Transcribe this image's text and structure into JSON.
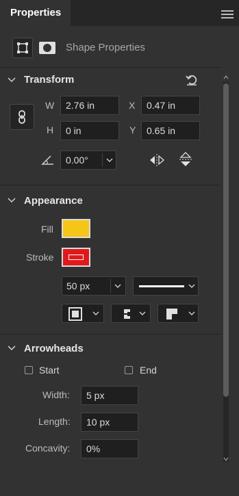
{
  "panel": {
    "tab_title": "Properties"
  },
  "shape_header": {
    "title": "Shape Properties"
  },
  "transform": {
    "title": "Transform",
    "w_label": "W",
    "w_value": "2.76 in",
    "x_label": "X",
    "x_value": "0.47 in",
    "h_label": "H",
    "h_value": "0 in",
    "y_label": "Y",
    "y_value": "0.65 in",
    "angle_value": "0.00°"
  },
  "appearance": {
    "title": "Appearance",
    "fill_label": "Fill",
    "fill_color": "#f5c518",
    "stroke_label": "Stroke",
    "stroke_color": "#e0191c",
    "stroke_width_value": "50 px"
  },
  "arrowheads": {
    "title": "Arrowheads",
    "start_label": "Start",
    "end_label": "End",
    "width_label": "Width:",
    "width_value": "5 px",
    "length_label": "Length:",
    "length_value": "10 px",
    "concavity_label": "Concavity:",
    "concavity_value": "0%"
  },
  "colors": {
    "panel_bg": "#323232",
    "field_bg": "#1f1f1f"
  }
}
